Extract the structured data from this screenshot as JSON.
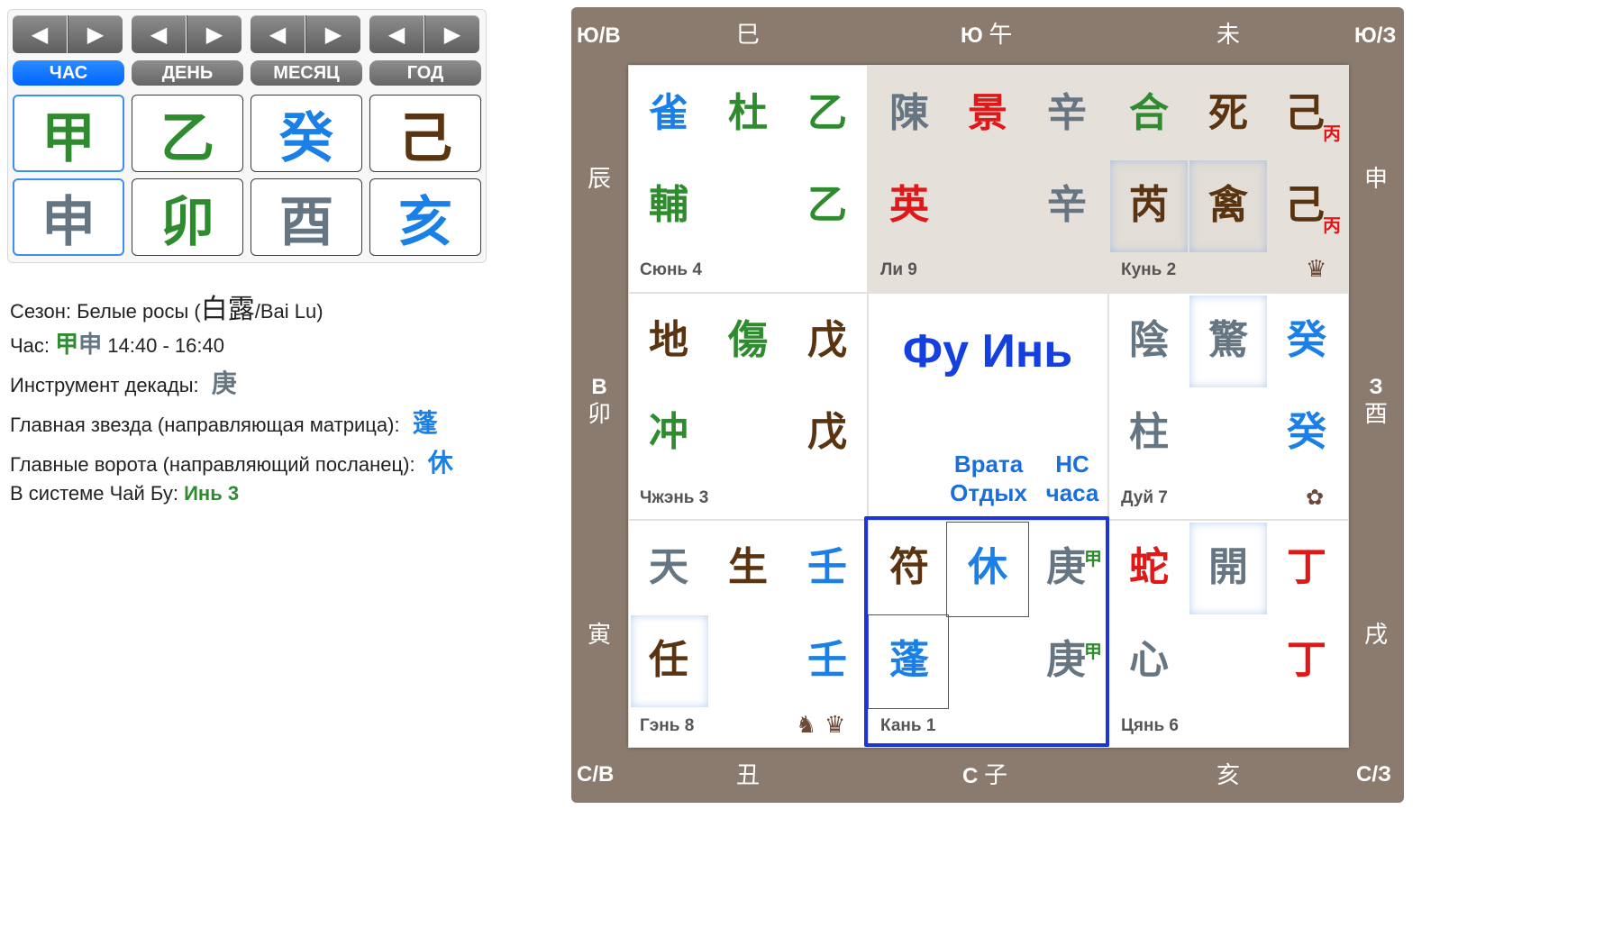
{
  "controls": {
    "arrows": {
      "prev": "◀",
      "next": "▶"
    },
    "units": [
      "ЧАС",
      "ДЕНЬ",
      "МЕСЯЦ",
      "ГОД"
    ],
    "active_unit": "ЧАС",
    "stems": [
      "甲",
      "乙",
      "癸",
      "己"
    ],
    "branches": [
      "申",
      "卯",
      "酉",
      "亥"
    ]
  },
  "info": {
    "season_label": "Сезон: Белые росы (",
    "season_hanzi": "白露",
    "season_suffix": "/Bai Lu)",
    "hour_label": "Час:",
    "hour_stem": "甲",
    "hour_branch": "申",
    "hour_time": "14:40 - 16:40",
    "decade_label": "Инструмент декады:",
    "decade_value": "庚",
    "star_label": "Главная звезда (направляющая матрица):",
    "star_value": "蓬",
    "door_label": "Главные ворота (направляющий посланец):",
    "door_value": "休",
    "chaibu_label": "В системе Чай Бу:",
    "chaibu_value": "Инь 3"
  },
  "board": {
    "directions": {
      "se": "Ю/В",
      "s": "Ю",
      "sw": "Ю/З",
      "e": "В",
      "w": "З",
      "ne": "С/В",
      "n": "С",
      "nw": "С/З"
    },
    "branches": {
      "si": "巳",
      "wu": "午",
      "wei": "未",
      "chen": "辰",
      "shen": "申",
      "mao": "卯",
      "you": "酉",
      "yin": "寅",
      "xu": "戌",
      "chou": "丑",
      "zi": "子",
      "hai": "亥"
    },
    "center": {
      "title": "Фу Инь",
      "gate_label": "Врата Отдых",
      "hour_label": "НС часа"
    },
    "palaces": {
      "xun": {
        "name": "Сюнь 4",
        "deity": "雀",
        "door": "杜",
        "heaven": "乙",
        "star": "輔",
        "earth": "乙"
      },
      "li": {
        "name": "Ли 9",
        "deity": "陳",
        "door": "景",
        "heaven": "辛",
        "star": "英",
        "earth": "辛"
      },
      "kun": {
        "name": "Кунь 2",
        "deity": "合",
        "door": "死",
        "heaven": "己",
        "heaven_sub": "丙",
        "star1": "芮",
        "star2": "禽",
        "earth": "己",
        "earth_sub": "丙",
        "badge": "♛"
      },
      "zhen": {
        "name": "Чжэнь 3",
        "deity": "地",
        "door": "傷",
        "heaven": "戊",
        "star": "冲",
        "earth": "戊"
      },
      "dui": {
        "name": "Дуй 7",
        "deity": "陰",
        "door": "驚",
        "heaven": "癸",
        "star": "柱",
        "earth": "癸",
        "badge": "✿"
      },
      "gen": {
        "name": "Гэнь 8",
        "deity": "天",
        "door": "生",
        "heaven": "壬",
        "star": "任",
        "earth": "壬",
        "badge1": "♞",
        "badge2": "♛"
      },
      "kan": {
        "name": "Кань 1",
        "deity": "符",
        "door": "休",
        "heaven": "庚",
        "heaven_sub": "甲",
        "star": "蓬",
        "earth": "庚",
        "earth_sub": "甲"
      },
      "qian": {
        "name": "Цянь 6",
        "deity": "蛇",
        "door": "開",
        "heaven": "丁",
        "star": "心",
        "earth": "丁"
      }
    }
  },
  "colors": {
    "accent_blue": "#0066ff",
    "board_brown": "#8a7b6e",
    "kan_frame": "#1c35d8"
  }
}
